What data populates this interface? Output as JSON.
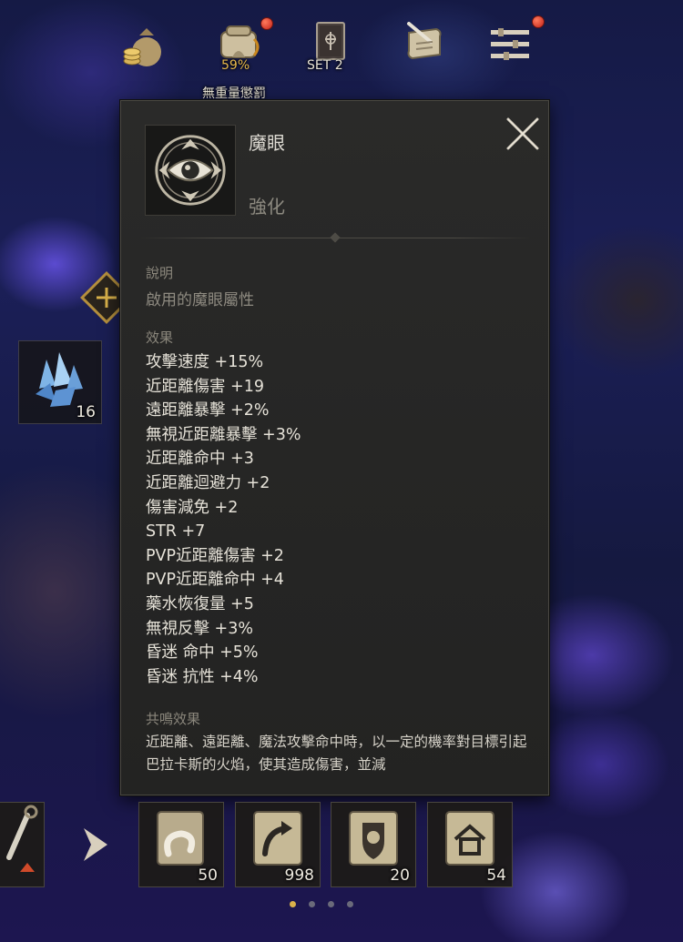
{
  "top_bar": {
    "weight": {
      "percent": "59%",
      "status": "無重量懲罰"
    },
    "set_label": "SET 2"
  },
  "tooltip": {
    "item_name": "魔眼",
    "item_type": "強化",
    "description_title": "說明",
    "description_text": "啟用的魔眼屬性",
    "effects_title": "效果",
    "effects": [
      "攻擊速度 +15%",
      "近距離傷害 +19",
      "遠距離暴擊 +2%",
      "無視近距離暴擊 +3%",
      "近距離命中 +3",
      "近距離迴避力 +2",
      "傷害減免 +2",
      "STR +7",
      "PVP近距離傷害 +2",
      "PVP近距離命中 +4",
      "藥水恢復量 +5",
      "無視反擊 +3%",
      "昏迷 命中 +5%",
      "昏迷 抗性 +4%"
    ],
    "resonance_title": "共鳴效果",
    "resonance_text": "近距離、遠距離、魔法攻擊命中時，以一定的機率對目標引起巴拉卡斯的火焰，使其造成傷害，並減"
  },
  "side": {
    "crystal_count": "16"
  },
  "quick_slots": [
    {
      "icon": "horn-scroll-icon",
      "count": "50"
    },
    {
      "icon": "return-scroll-icon",
      "count": "998"
    },
    {
      "icon": "lion-shield-scroll-icon",
      "count": "20"
    },
    {
      "icon": "home-scroll-icon",
      "count": "54"
    }
  ],
  "colors": {
    "accent_gold": "#d9b14a",
    "panel_bg": "#262625",
    "text_main": "#e6e2d8",
    "text_muted": "#8e8a80"
  }
}
